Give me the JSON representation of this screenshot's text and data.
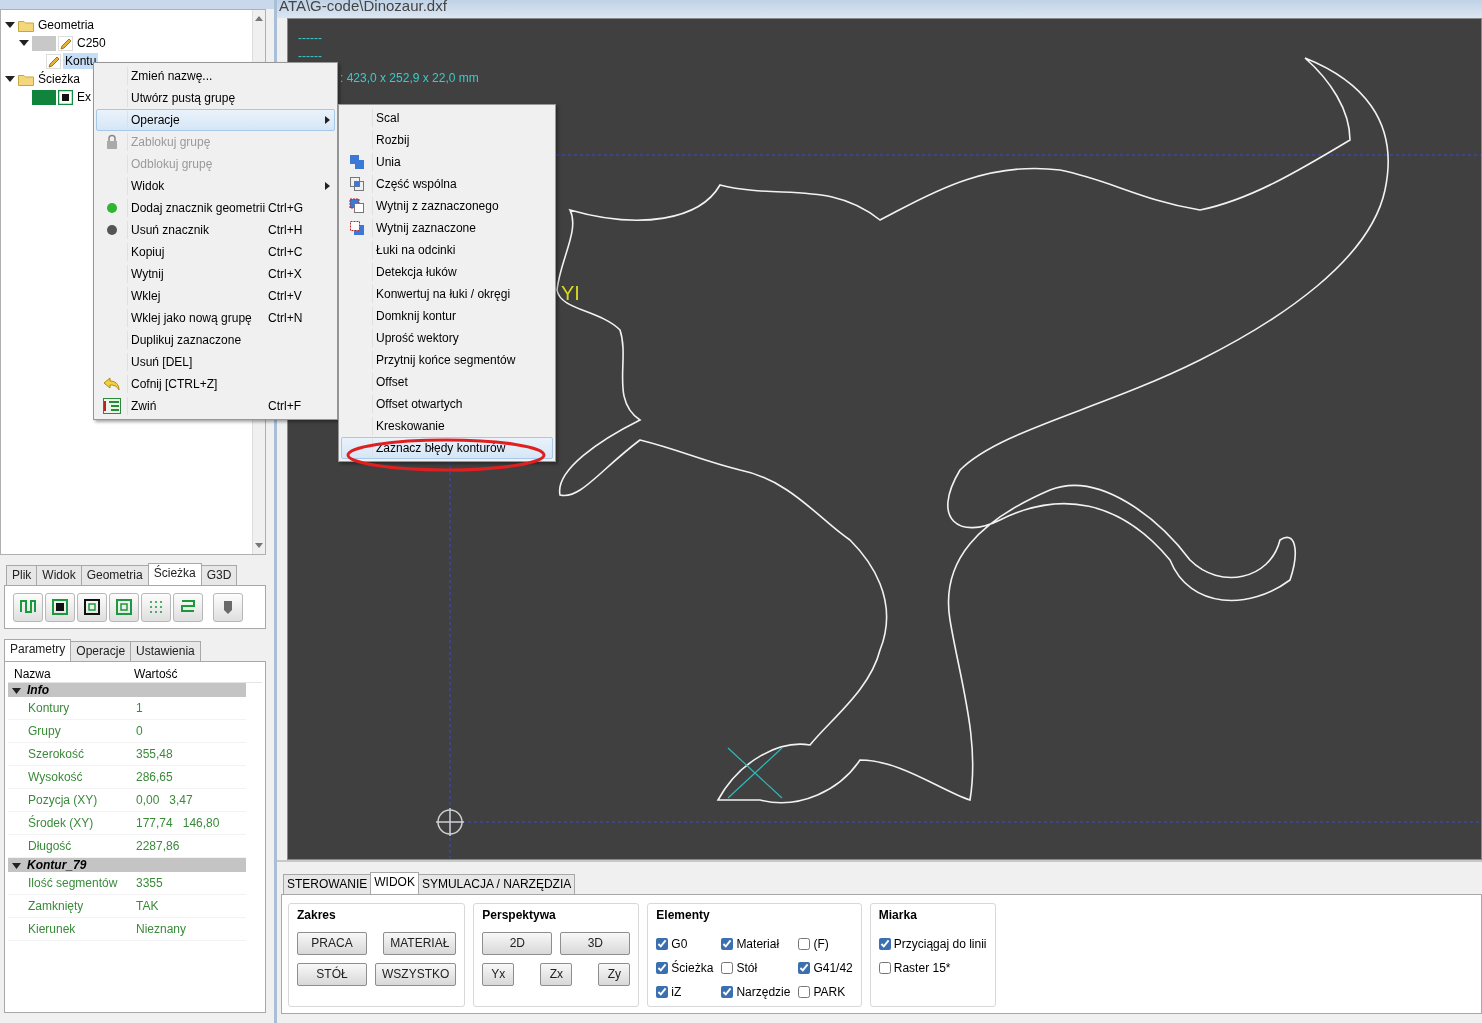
{
  "window": {
    "title": "ATA\\G-code\\Dinozaur.dxf"
  },
  "tree": [
    {
      "kind": "folder",
      "label": "Geometria",
      "expanded": true,
      "selected": false,
      "children": [
        {
          "kind": "layer",
          "label": "C250",
          "color": "#c8c8c8",
          "expanded": true,
          "selected": false,
          "children": [
            {
              "kind": "contour",
              "label": "Kontu",
              "selected": true
            }
          ]
        }
      ]
    },
    {
      "kind": "folder",
      "label": "Ścieżka",
      "expanded": true,
      "selected": false,
      "children": [
        {
          "kind": "path",
          "label": "Ex",
          "color": "#10843c",
          "selected": false
        }
      ]
    }
  ],
  "tool_tabs": [
    {
      "label": "Plik",
      "selected": false
    },
    {
      "label": "Widok",
      "selected": false
    },
    {
      "label": "Geometria",
      "selected": false
    },
    {
      "label": "Ścieżka",
      "selected": true
    },
    {
      "label": "G3D",
      "selected": false
    }
  ],
  "param_tabs": [
    {
      "label": "Parametry",
      "selected": true
    },
    {
      "label": "Operacje",
      "selected": false
    },
    {
      "label": "Ustawienia",
      "selected": false
    }
  ],
  "properties": {
    "columns": [
      "Nazwa",
      "Wartość"
    ],
    "sections": [
      {
        "title": "Info",
        "expanded": true,
        "rows": [
          {
            "name": "Kontury",
            "value": "1"
          },
          {
            "name": "Grupy",
            "value": "0"
          },
          {
            "name": "Szerokość",
            "value": "355,48"
          },
          {
            "name": "Wysokość",
            "value": "286,65"
          },
          {
            "name": "Pozycja (XY)",
            "value": "0,00   3,47"
          },
          {
            "name": "Środek (XY)",
            "value": "177,74   146,80"
          },
          {
            "name": "Długość",
            "value": "2287,86"
          }
        ]
      },
      {
        "title": "Kontur_79",
        "expanded": true,
        "rows": [
          {
            "name": "Ilość segmentów",
            "value": "3355"
          },
          {
            "name": "Zamknięty",
            "value": "TAK"
          },
          {
            "name": "Kierunek",
            "value": "Nieznany"
          }
        ]
      }
    ]
  },
  "canvas": {
    "info_lines": [
      "------",
      "------",
      ": 423,0 x 252,9 x 22,0 mm"
    ],
    "axis_label": "YI"
  },
  "context_menu": [
    {
      "label": "Zmień nazwę...",
      "kind": "plain",
      "disabled": false,
      "submenu": false,
      "selected": false
    },
    {
      "label": "Utwórz pustą grupę",
      "kind": "plain",
      "disabled": false,
      "submenu": false,
      "selected": false
    },
    {
      "label": "Operacje",
      "kind": "plain",
      "disabled": false,
      "submenu": true,
      "selected": true
    },
    {
      "label": "Zablokuj grupę",
      "kind": "lock",
      "disabled": true,
      "submenu": false,
      "selected": false
    },
    {
      "label": "Odblokuj grupę",
      "kind": "plain",
      "disabled": true,
      "submenu": false,
      "selected": false
    },
    {
      "label": "Widok",
      "kind": "plain",
      "disabled": false,
      "submenu": true,
      "selected": false
    },
    {
      "label": "Dodaj znacznik geometrii",
      "shortcut": "Ctrl+G",
      "kind": "dot",
      "color": "#2fb52f",
      "disabled": false,
      "submenu": false,
      "selected": false
    },
    {
      "label": "Usuń znacznik",
      "shortcut": "Ctrl+H",
      "kind": "dot",
      "color": "#555555",
      "disabled": false,
      "submenu": false,
      "selected": false
    },
    {
      "label": "Kopiuj",
      "shortcut": "Ctrl+C",
      "kind": "plain",
      "disabled": false,
      "submenu": false,
      "selected": false
    },
    {
      "label": "Wytnij",
      "shortcut": "Ctrl+X",
      "kind": "plain",
      "disabled": false,
      "submenu": false,
      "selected": false
    },
    {
      "label": "Wklej",
      "shortcut": "Ctrl+V",
      "kind": "plain",
      "disabled": false,
      "submenu": false,
      "selected": false
    },
    {
      "label": "Wklej jako nową grupę",
      "shortcut": "Ctrl+N",
      "kind": "plain",
      "disabled": false,
      "submenu": false,
      "selected": false
    },
    {
      "label": "Duplikuj zaznaczone",
      "kind": "plain",
      "disabled": false,
      "submenu": false,
      "selected": false
    },
    {
      "label": "Usuń [DEL]",
      "kind": "plain",
      "disabled": false,
      "submenu": false,
      "selected": false
    },
    {
      "label": "Cofnij [CTRL+Z]",
      "kind": "undo",
      "disabled": false,
      "submenu": false,
      "selected": false
    },
    {
      "label": "Zwiń",
      "shortcut": "Ctrl+F",
      "kind": "collapse",
      "disabled": false,
      "submenu": false,
      "selected": false
    }
  ],
  "submenu": [
    {
      "label": "Scal",
      "kind": "plain",
      "selected": false
    },
    {
      "label": "Rozbij",
      "kind": "plain",
      "selected": false
    },
    {
      "label": "Unia",
      "kind": "union",
      "selected": false
    },
    {
      "label": "Część wspólna",
      "kind": "intersect",
      "selected": false
    },
    {
      "label": "Wytnij z zaznaczonego",
      "kind": "cut-from",
      "selected": false
    },
    {
      "label": "Wytnij zaznaczone",
      "kind": "cut-selected",
      "selected": false
    },
    {
      "label": "Łuki na odcinki",
      "kind": "plain",
      "selected": false
    },
    {
      "label": "Detekcja łuków",
      "kind": "plain",
      "selected": false
    },
    {
      "label": "Konwertuj na łuki / okręgi",
      "kind": "plain",
      "selected": false
    },
    {
      "label": "Domknij kontur",
      "kind": "plain",
      "selected": false
    },
    {
      "label": "Uprość wektory",
      "kind": "plain",
      "selected": false
    },
    {
      "label": "Przytnij końce segmentów",
      "kind": "plain",
      "selected": false
    },
    {
      "label": "Offset",
      "kind": "plain",
      "selected": false
    },
    {
      "label": "Offset otwartych",
      "kind": "plain",
      "selected": false
    },
    {
      "label": "Kreskowanie",
      "kind": "plain",
      "selected": false
    },
    {
      "label": "Zaznacz błędy konturów",
      "kind": "plain",
      "selected": true
    }
  ],
  "bottom_tabs": [
    {
      "label": "STEROWANIE",
      "selected": false
    },
    {
      "label": "WIDOK",
      "selected": true
    },
    {
      "label": "SYMULACJA / NARZĘDZIA",
      "selected": false
    }
  ],
  "view_groups": [
    {
      "kind": "buttons",
      "title": "Zakres",
      "rows": [
        [
          "PRACA",
          "MATERIAŁ"
        ],
        [
          "STÓŁ",
          "WSZYSTKO"
        ]
      ]
    },
    {
      "kind": "buttons",
      "title": "Perspektywa",
      "rows": [
        [
          "2D",
          "3D"
        ],
        [
          "Yx",
          "Zx",
          "Zy"
        ]
      ]
    },
    {
      "kind": "checks",
      "title": "Elementy",
      "rows": [
        [
          {
            "label": "G0",
            "checked": true
          },
          {
            "label": "Materiał",
            "checked": true
          },
          {
            "label": "(F)",
            "checked": false
          }
        ],
        [
          {
            "label": "Ścieżka",
            "checked": true
          },
          {
            "label": "Stół",
            "checked": false
          },
          {
            "label": "G41/42",
            "checked": true
          }
        ],
        [
          {
            "label": "iZ",
            "checked": true
          },
          {
            "label": "Narzędzie",
            "checked": true
          },
          {
            "label": "PARK",
            "checked": false
          }
        ]
      ]
    },
    {
      "kind": "checks",
      "title": "Miarka",
      "rows": [
        [
          {
            "label": "Przyciągaj do linii",
            "checked": true
          }
        ],
        [
          {
            "label": "Raster 15*",
            "checked": false
          }
        ]
      ]
    }
  ]
}
